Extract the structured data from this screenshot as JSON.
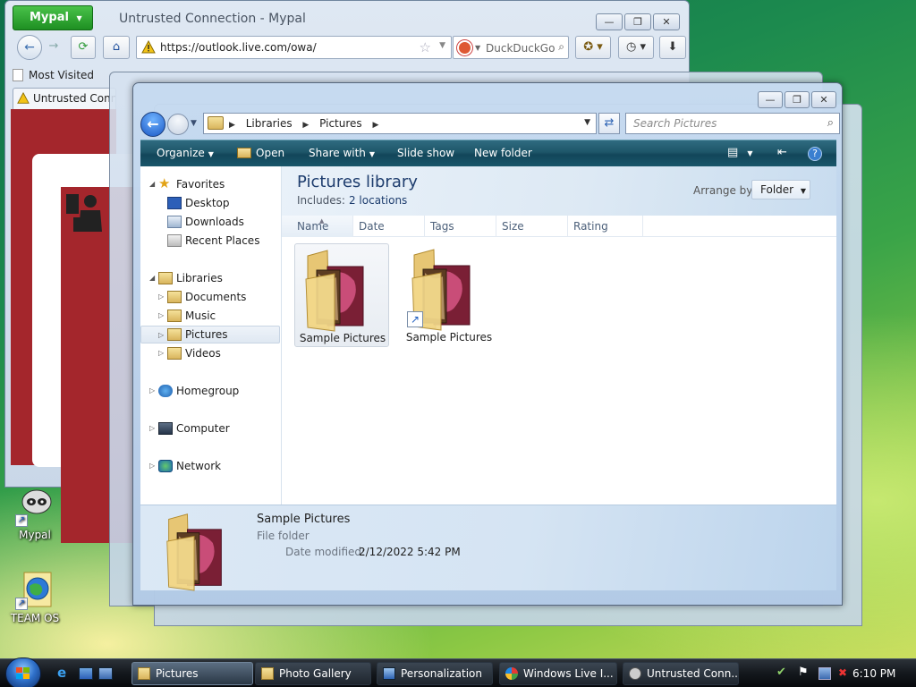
{
  "desktop": {
    "icons": [
      {
        "label": "Mypal",
        "icon": "raccoon-icon"
      },
      {
        "label": "TEAM OS",
        "icon": "globe-icon"
      }
    ]
  },
  "browser": {
    "menu_label": "Mypal",
    "title": "Untrusted Connection - Mypal",
    "url": "https://outlook.live.com/owa/",
    "search_engine": "DuckDuckGo",
    "bookmark": "Most Visited",
    "tab_title": "Untrusted Connection"
  },
  "explorer": {
    "breadcrumb": [
      "Libraries",
      "Pictures"
    ],
    "search_placeholder": "Search Pictures",
    "toolbar": {
      "organize": "Organize",
      "open": "Open",
      "share_with": "Share with",
      "slide_show": "Slide show",
      "new_folder": "New folder"
    },
    "nav": {
      "favorites": "Favorites",
      "desktop": "Desktop",
      "downloads": "Downloads",
      "recent_places": "Recent Places",
      "libraries": "Libraries",
      "documents": "Documents",
      "music": "Music",
      "pictures": "Pictures",
      "videos": "Videos",
      "homegroup": "Homegroup",
      "computer": "Computer",
      "network": "Network"
    },
    "library": {
      "title": "Pictures library",
      "includes_label": "Includes:",
      "includes_value": "2 locations",
      "arrange_label": "Arrange by:",
      "arrange_value": "Folder"
    },
    "columns": [
      "Name",
      "Date",
      "Tags",
      "Size",
      "Rating"
    ],
    "items": [
      {
        "label": "Sample Pictures",
        "shortcut": false
      },
      {
        "label": "Sample Pictures",
        "shortcut": true
      }
    ],
    "details": {
      "name": "Sample Pictures",
      "type": "File folder",
      "date_label": "Date modified:",
      "date_value": "2/12/2022 5:42 PM"
    }
  },
  "taskbar": {
    "tasks": [
      "Pictures",
      "Photo Gallery",
      "Personalization",
      "Windows Live I...",
      "Untrusted Conn..."
    ],
    "clock": "6:10 PM"
  },
  "colors": {
    "accent_blue": "#1b58c5",
    "toolbar_teal": "#1e5669",
    "error_red": "#a4262c",
    "mypal_green": "#1e8f22"
  }
}
